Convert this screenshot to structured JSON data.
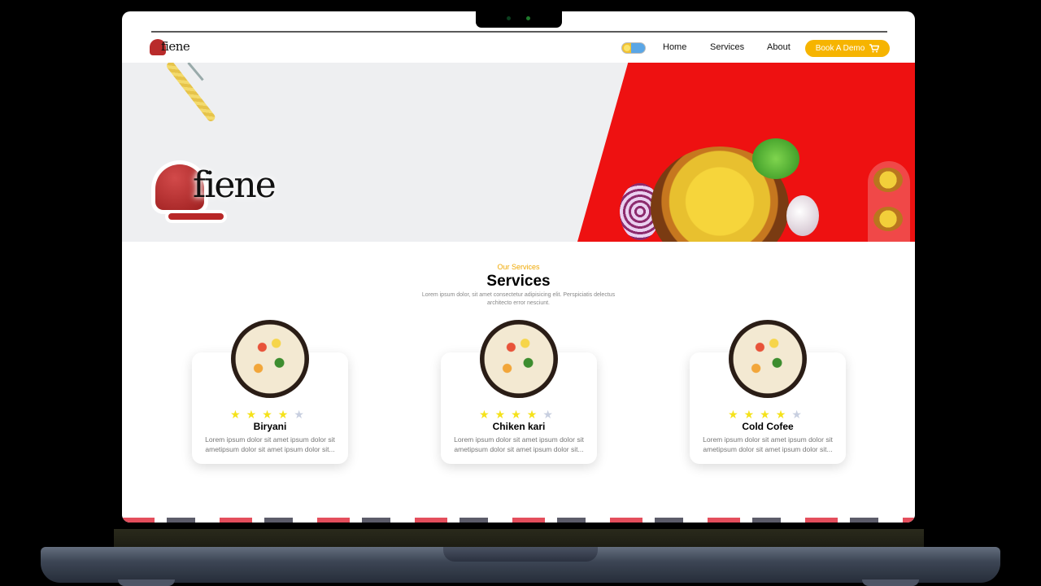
{
  "nav": {
    "logo_text": "fiene",
    "links": [
      "Home",
      "Services",
      "About"
    ],
    "cta_label": "Book A Demo",
    "cta_icon": "cart-icon"
  },
  "hero": {
    "logo_text": "fiene"
  },
  "services": {
    "kicker": "Our Services",
    "title": "Services",
    "description": "Lorem ipsum dolor, sit amet consectetur adipisicing elit. Perspiciatis delectus architecto error nesciunt.",
    "cards": [
      {
        "title": "Biryani",
        "rating": 4,
        "max_rating": 5,
        "desc": "Lorem ipsum dolor sit amet ipsum dolor sit ametipsum dolor sit amet ipsum dolor sit..."
      },
      {
        "title": "Chiken kari",
        "rating": 4,
        "max_rating": 5,
        "desc": "Lorem ipsum dolor sit amet ipsum dolor sit ametipsum dolor sit amet ipsum dolor sit..."
      },
      {
        "title": "Cold Cofee",
        "rating": 4,
        "max_rating": 5,
        "desc": "Lorem ipsum dolor sit amet ipsum dolor sit ametipsum dolor sit amet ipsum dolor sit..."
      }
    ]
  },
  "colors": {
    "accent": "#f6b400",
    "hero_red": "#ee1111",
    "kicker": "#f0a800"
  }
}
